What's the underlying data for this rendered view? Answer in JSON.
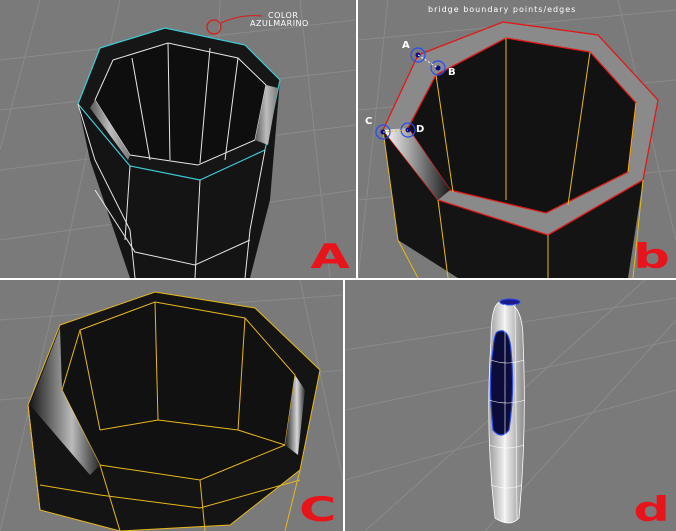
{
  "panels": {
    "a": {
      "label": "A",
      "annotation_line1": "COLOR",
      "annotation_line2": "AZULMARINO"
    },
    "b": {
      "label": "b",
      "title": "bridge boundary points/edges",
      "points": {
        "a": "A",
        "b": "B",
        "c": "C",
        "d": "D"
      }
    },
    "c": {
      "label": "C"
    },
    "d": {
      "label": "d"
    }
  },
  "colors": {
    "viewport_bg": "#7a7a7a",
    "grid_line": "#8c8c8c",
    "mesh_dark": "#121212",
    "edge_white": "#e6e6e6",
    "edge_cyan": "#3ec9d6",
    "edge_red": "#e01818",
    "edge_yellow": "#e8b81c",
    "marker_blue": "#2a4cf0",
    "label_red": "#e8141c"
  }
}
